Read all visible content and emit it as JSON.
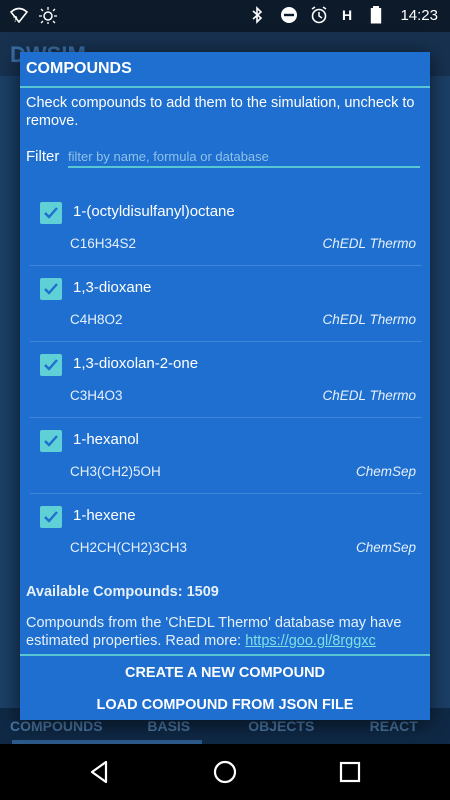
{
  "status_bar": {
    "time": "14:23",
    "icons": [
      "wifi-question-icon",
      "sun-alert-icon",
      "bluetooth-icon",
      "do-not-disturb-icon",
      "alarm-icon",
      "signal-h-icon",
      "battery-icon"
    ]
  },
  "background_app": {
    "title": "DWSIM",
    "tabs": [
      "COMPOUNDS",
      "BASIS",
      "OBJECTS",
      "REACT"
    ]
  },
  "dialog": {
    "title": "COMPOUNDS",
    "instructions": "Check compounds to add them to the simulation, uncheck to remove.",
    "filter_label": "Filter",
    "filter_placeholder": "filter by name, formula or database",
    "filter_value": "",
    "compounds": [
      {
        "name": "1-(octyldisulfanyl)octane",
        "formula": "C16H34S2",
        "source": "ChEDL Thermo",
        "checked": true
      },
      {
        "name": "1,3-dioxane",
        "formula": "C4H8O2",
        "source": "ChEDL Thermo",
        "checked": true
      },
      {
        "name": "1,3-dioxolan-2-one",
        "formula": "C3H4O3",
        "source": "ChEDL Thermo",
        "checked": true
      },
      {
        "name": "1-hexanol",
        "formula": "CH3(CH2)5OH",
        "source": "ChemSep",
        "checked": true
      },
      {
        "name": "1-hexene",
        "formula": "CH2CH(CH2)3CH3",
        "source": "ChemSep",
        "checked": true
      }
    ],
    "available_text": "Available Compounds: 1509",
    "note_text": "Compounds from the 'ChEDL Thermo' database may have estimated properties. Read more: ",
    "note_link": "https://goo.gl/8rggxc",
    "button_create": "CREATE A NEW COMPOUND",
    "button_load": "LOAD COMPOUND FROM JSON FILE"
  },
  "colors": {
    "dialog_bg": "#1e6fcf",
    "accent": "#59c6d4",
    "checkbox": "#5fd0d6"
  }
}
